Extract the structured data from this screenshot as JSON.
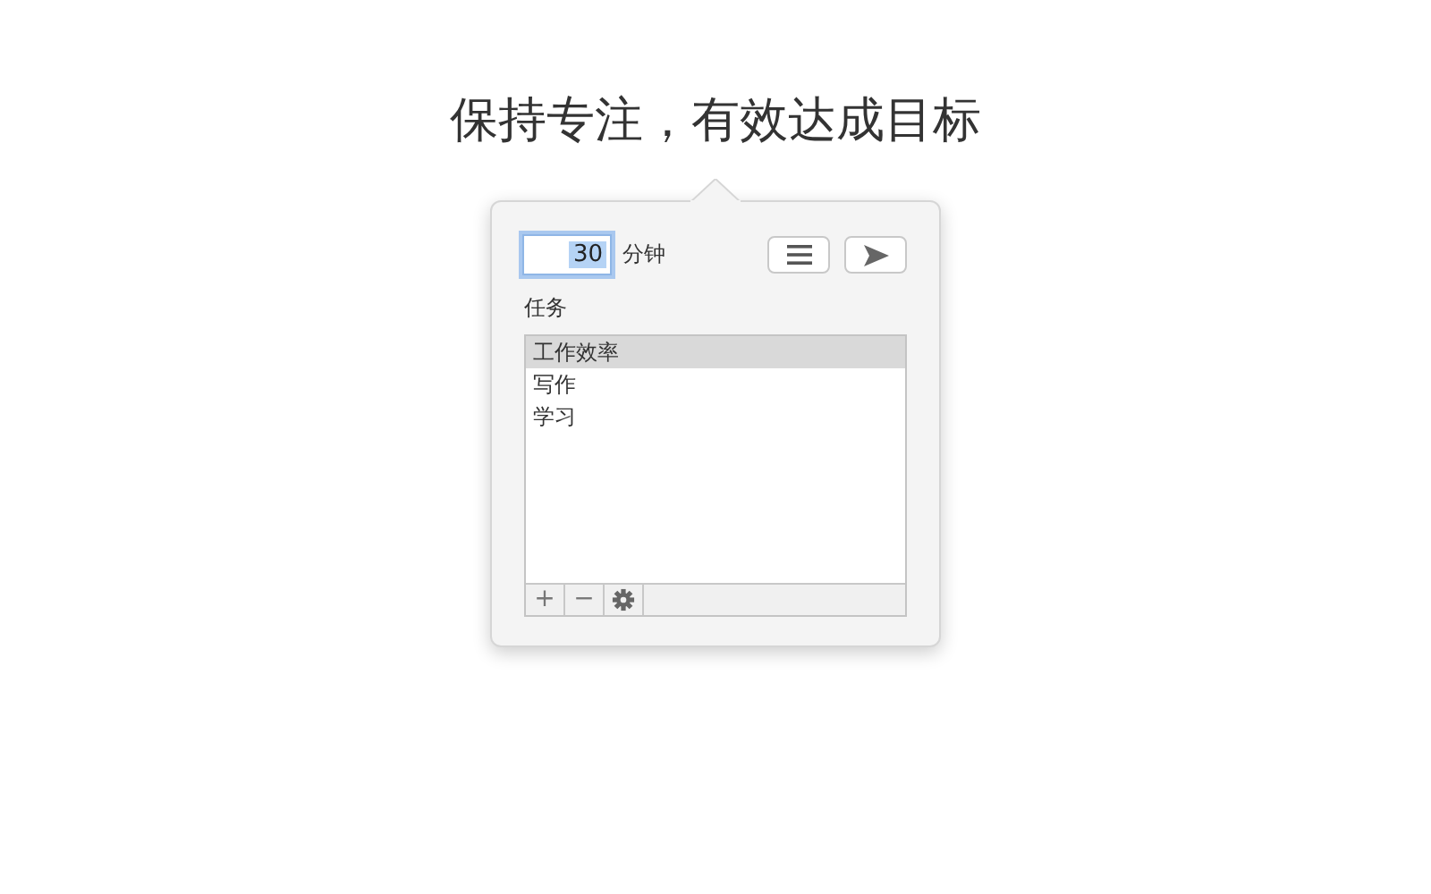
{
  "headline": "保持专注，有效达成目标",
  "popover": {
    "duration": {
      "value": "30",
      "focused": true
    },
    "unit": "分钟",
    "buttons": [
      {
        "kind": "list"
      },
      {
        "kind": "send"
      }
    ],
    "tasks_label": "任务",
    "tasks": [
      {
        "label": "工作效率",
        "selected": true
      },
      {
        "label": "写作",
        "selected": false
      },
      {
        "label": "学习",
        "selected": false
      }
    ],
    "footer": [
      {
        "kind": "text",
        "label": "+"
      },
      {
        "kind": "text",
        "label": "−"
      },
      {
        "kind": "gear"
      }
    ]
  }
}
